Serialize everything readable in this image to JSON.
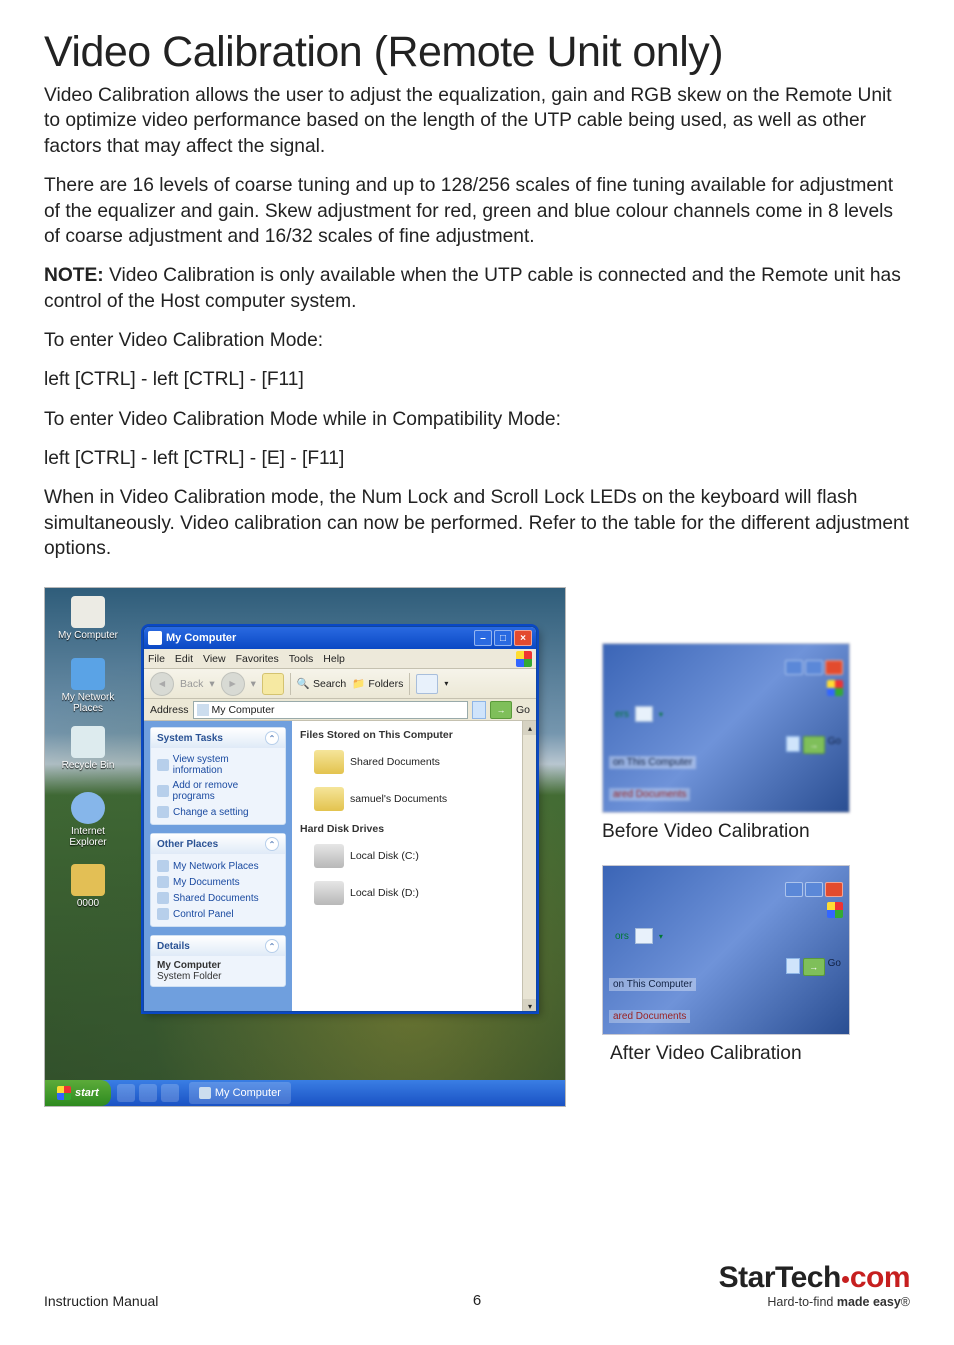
{
  "doc": {
    "heading": "Video Calibration (Remote Unit only)",
    "p1": "Video Calibration allows the user to adjust the equalization, gain and RGB skew on the Remote Unit to optimize video performance based on the length of the UTP cable being used, as well as other factors that may affect the signal.",
    "p2": "There are 16 levels of coarse tuning and up to 128/256 scales of fine tuning available for adjustment of the equalizer and gain.  Skew adjustment for red, green and blue colour channels come in 8 levels of coarse adjustment and 16/32 scales of fine adjustment.",
    "note_label": "NOTE:",
    "p3": " Video Calibration is only available when the UTP cable is connected and the Remote unit has control of the Host computer system.",
    "p4": "To enter Video Calibration Mode:",
    "p5": "left [CTRL] - left [CTRL] - [F11]",
    "p6": "To enter Video Calibration Mode while in Compatibility Mode:",
    "p7": "left [CTRL] - left [CTRL] - [E] - [F11]",
    "p8": "When in Video Calibration mode, the Num Lock and Scroll Lock LEDs on the keyboard will flash simultaneously.  Video calibration can now be performed.  Refer to the table for the different adjustment options."
  },
  "desktop_icons": {
    "i1": "My Computer",
    "i2": "My Network Places",
    "i3": "Recycle Bin",
    "i4": "Internet Explorer",
    "i5": "0000"
  },
  "win": {
    "title": "My Computer",
    "menu": [
      "File",
      "Edit",
      "View",
      "Favorites",
      "Tools",
      "Help"
    ],
    "tool_back": "Back",
    "tool_search": "Search",
    "tool_folders": "Folders",
    "addr_label": "Address",
    "addr_value": "My Computer",
    "go": "Go",
    "left": {
      "system_tasks": "System Tasks",
      "st_items": [
        "View system information",
        "Add or remove programs",
        "Change a setting"
      ],
      "other_places": "Other Places",
      "op_items": [
        "My Network Places",
        "My Documents",
        "Shared Documents",
        "Control Panel"
      ],
      "details": "Details",
      "details_title": "My Computer",
      "details_sub": "System Folder"
    },
    "right": {
      "h1": "Files Stored on This Computer",
      "i1": "Shared Documents",
      "i2": "samuel's Documents",
      "h2": "Hard Disk Drives",
      "i3": "Local Disk (C:)",
      "i4": "Local Disk (D:)"
    }
  },
  "taskbar": {
    "start": "start",
    "task": "My Computer"
  },
  "mini": {
    "before_cap": "Before Video Calibration",
    "after_cap": "After Video Calibration",
    "ers": "ers",
    "ors": "ors",
    "go": "Go",
    "on_this": "on This Computer",
    "ared_docs": "ared Documents"
  },
  "footer": {
    "left": "Instruction Manual",
    "page": "6",
    "brand_a": "StarTech",
    "brand_b": "com",
    "tag_a": "Hard-to-find ",
    "tag_b": "made easy",
    "reg": "®"
  }
}
